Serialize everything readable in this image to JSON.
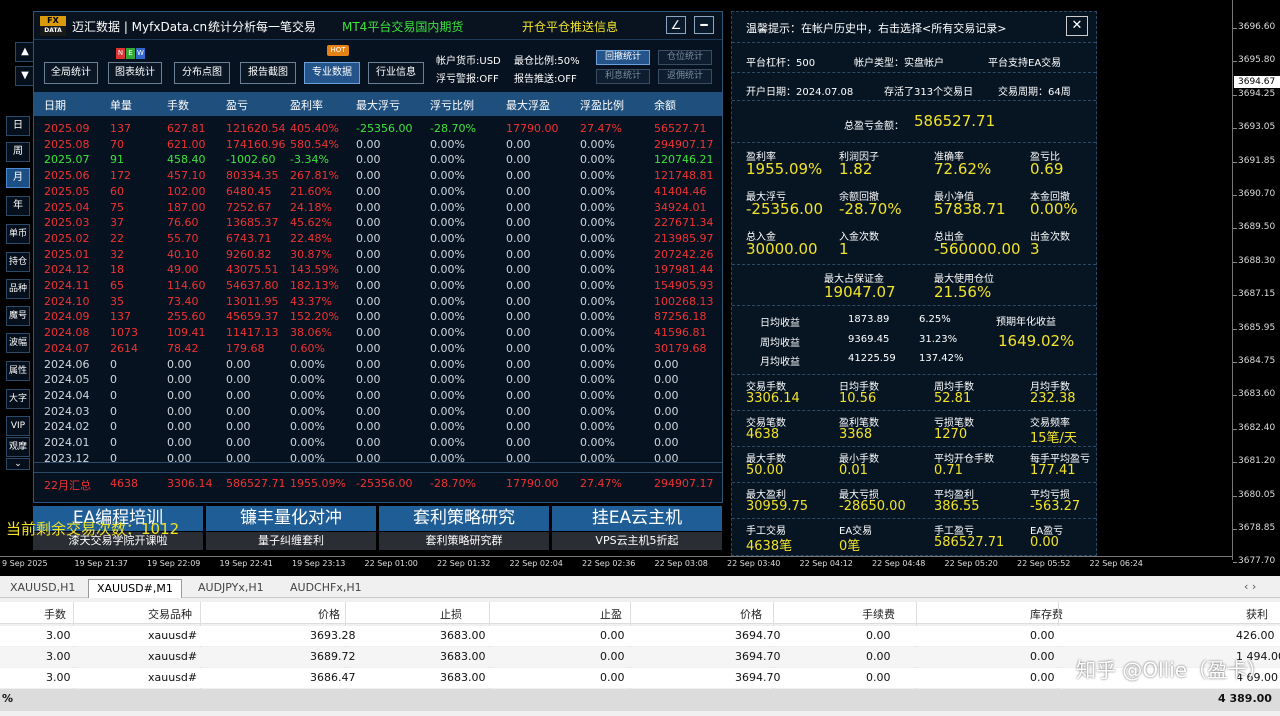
{
  "chart": {
    "price_ticks": [
      "3696.60",
      "3695.80",
      "3694.25",
      "3693.05",
      "3691.85",
      "3690.70",
      "3689.50",
      "3688.30",
      "3687.15",
      "3685.95",
      "3684.75",
      "3683.60",
      "3682.40",
      "3681.20",
      "3680.05",
      "3678.85",
      "3677.70"
    ],
    "current_price": "3694.67",
    "time_ticks": [
      "9 Sep 2025",
      "19 Sep 21:37",
      "19 Sep 22:09",
      "19 Sep 22:41",
      "19 Sep 23:13",
      "22 Sep 01:00",
      "22 Sep 01:32",
      "22 Sep 02:04",
      "22 Sep 02:36",
      "22 Sep 03:08",
      "22 Sep 03:40",
      "22 Sep 04:12",
      "22 Sep 04:48",
      "22 Sep 05:20",
      "22 Sep 05:52",
      "22 Sep 06:24"
    ],
    "up_arrow": "▲",
    "down_arrow": "▼"
  },
  "leftnav": {
    "items": [
      "日",
      "周",
      "月",
      "年",
      "单币",
      "持仓",
      "品种",
      "魔号",
      "波幅",
      "属性",
      "大字",
      "VIP",
      "观摩"
    ],
    "more": "⌄"
  },
  "main": {
    "logo_top": "FX",
    "logo_bottom": "DATA",
    "brand": "迈汇数据 | MyfxData.cn",
    "slogan": "统计分析每一笔交易",
    "promo1": "MT4平台交易国内期货",
    "promo2": "开仓平仓推送信息",
    "edit_icon": "∠",
    "min_icon": "━",
    "new_letters": [
      "N",
      "E",
      "W"
    ],
    "hot_label": "HOT",
    "nav": [
      "全局统计",
      "图表统计",
      "分布点图",
      "报告截图",
      "专业数据",
      "行业信息"
    ],
    "info": {
      "currency": "帐户货币:USD",
      "max_pos": "最仓比例:50%",
      "float_alert": "浮亏警报:OFF",
      "push": "报告推送:OFF"
    },
    "smallbtns": [
      "回撤统计",
      "仓位统计",
      "利息统计",
      "返佣统计"
    ],
    "headers": [
      "日期",
      "单量",
      "手数",
      "盈亏",
      "盈利率",
      "最大浮亏",
      "浮亏比例",
      "最大浮盈",
      "浮盈比例",
      "余额"
    ],
    "rows": [
      [
        "2025.09",
        "137",
        "627.81",
        "121620.54",
        "405.40%",
        "-25356.00",
        "-28.70%",
        "17790.00",
        "27.47%",
        "56527.71"
      ],
      [
        "2025.08",
        "70",
        "621.00",
        "174160.96",
        "580.54%",
        "0.00",
        "0.00%",
        "0.00",
        "0.00%",
        "294907.17"
      ],
      [
        "2025.07",
        "91",
        "458.40",
        "-1002.60",
        "-3.34%",
        "0.00",
        "0.00%",
        "0.00",
        "0.00%",
        "120746.21"
      ],
      [
        "2025.06",
        "172",
        "457.10",
        "80334.35",
        "267.81%",
        "0.00",
        "0.00%",
        "0.00",
        "0.00%",
        "121748.81"
      ],
      [
        "2025.05",
        "60",
        "102.00",
        "6480.45",
        "21.60%",
        "0.00",
        "0.00%",
        "0.00",
        "0.00%",
        "41404.46"
      ],
      [
        "2025.04",
        "75",
        "187.00",
        "7252.67",
        "24.18%",
        "0.00",
        "0.00%",
        "0.00",
        "0.00%",
        "34924.01"
      ],
      [
        "2025.03",
        "37",
        "76.60",
        "13685.37",
        "45.62%",
        "0.00",
        "0.00%",
        "0.00",
        "0.00%",
        "227671.34"
      ],
      [
        "2025.02",
        "22",
        "55.70",
        "6743.71",
        "22.48%",
        "0.00",
        "0.00%",
        "0.00",
        "0.00%",
        "213985.97"
      ],
      [
        "2025.01",
        "32",
        "40.10",
        "9260.82",
        "30.87%",
        "0.00",
        "0.00%",
        "0.00",
        "0.00%",
        "207242.26"
      ],
      [
        "2024.12",
        "18",
        "49.00",
        "43075.51",
        "143.59%",
        "0.00",
        "0.00%",
        "0.00",
        "0.00%",
        "197981.44"
      ],
      [
        "2024.11",
        "65",
        "114.60",
        "54637.80",
        "182.13%",
        "0.00",
        "0.00%",
        "0.00",
        "0.00%",
        "154905.93"
      ],
      [
        "2024.10",
        "35",
        "73.40",
        "13011.95",
        "43.37%",
        "0.00",
        "0.00%",
        "0.00",
        "0.00%",
        "100268.13"
      ],
      [
        "2024.09",
        "137",
        "255.60",
        "45659.37",
        "152.20%",
        "0.00",
        "0.00%",
        "0.00",
        "0.00%",
        "87256.18"
      ],
      [
        "2024.08",
        "1073",
        "109.41",
        "11417.13",
        "38.06%",
        "0.00",
        "0.00%",
        "0.00",
        "0.00%",
        "41596.81"
      ],
      [
        "2024.07",
        "2614",
        "78.42",
        "179.68",
        "0.60%",
        "0.00",
        "0.00%",
        "0.00",
        "0.00%",
        "30179.68"
      ],
      [
        "2024.06",
        "0",
        "0.00",
        "0.00",
        "0.00%",
        "0.00",
        "0.00%",
        "0.00",
        "0.00%",
        "0.00"
      ],
      [
        "2024.05",
        "0",
        "0.00",
        "0.00",
        "0.00%",
        "0.00",
        "0.00%",
        "0.00",
        "0.00%",
        "0.00"
      ],
      [
        "2024.04",
        "0",
        "0.00",
        "0.00",
        "0.00%",
        "0.00",
        "0.00%",
        "0.00",
        "0.00%",
        "0.00"
      ],
      [
        "2024.03",
        "0",
        "0.00",
        "0.00",
        "0.00%",
        "0.00",
        "0.00%",
        "0.00",
        "0.00%",
        "0.00"
      ],
      [
        "2024.02",
        "0",
        "0.00",
        "0.00",
        "0.00%",
        "0.00",
        "0.00%",
        "0.00",
        "0.00%",
        "0.00"
      ],
      [
        "2024.01",
        "0",
        "0.00",
        "0.00",
        "0.00%",
        "0.00",
        "0.00%",
        "0.00",
        "0.00%",
        "0.00"
      ],
      [
        "2023.12",
        "0",
        "0.00",
        "0.00",
        "0.00%",
        "0.00",
        "0.00%",
        "0.00",
        "0.00%",
        "0.00"
      ]
    ],
    "row_colors": [
      "red",
      "red",
      "green",
      "red",
      "red",
      "red",
      "red",
      "red",
      "red",
      "red",
      "red",
      "red",
      "red",
      "red",
      "red",
      "gray",
      "gray",
      "gray",
      "gray",
      "gray",
      "gray",
      "gray"
    ],
    "total": [
      "22月汇总",
      "4638",
      "3306.14",
      "586527.71",
      "1955.09%",
      "-25356.00",
      "-28.70%",
      "17790.00",
      "27.47%",
      "294907.17"
    ]
  },
  "banners": [
    {
      "big": "EA编程培训",
      "small": "漆天交易学院开课啦"
    },
    {
      "big": "镰丰量化对冲",
      "small": "量子纠缠套利"
    },
    {
      "big": "套利策略研究",
      "small": "套利策略研究群"
    },
    {
      "big": "挂EA云主机",
      "small": "VPS云主机5折起"
    }
  ],
  "remain_text": "当前剩余交易次数：1012",
  "right": {
    "tip": "温馨提示：在帐户历史中，右击选择<所有交易记录>",
    "close": "✕",
    "leverage": "平台杠杆：500",
    "acct_type": "帐户类型：实盘帐户",
    "ea_support": "平台支持EA交易",
    "open_date": "开户日期：2024.07.08",
    "alive": "存活了313个交易日",
    "period": "交易周期：64周",
    "total_profit_label": "总盈亏金额：",
    "total_profit": "586527.71",
    "grid1": [
      {
        "l": "盈利率",
        "v": "1955.09%"
      },
      {
        "l": "利润因子",
        "v": "1.82"
      },
      {
        "l": "准确率",
        "v": "72.62%"
      },
      {
        "l": "盈亏比",
        "v": "0.69"
      },
      {
        "l": "最大浮亏",
        "v": "-25356.00"
      },
      {
        "l": "余额回撤",
        "v": "-28.70%"
      },
      {
        "l": "最小净值",
        "v": "57838.71"
      },
      {
        "l": "本金回撤",
        "v": "0.00%"
      },
      {
        "l": "总入金",
        "v": "30000.00"
      },
      {
        "l": "入金次数",
        "v": "1"
      },
      {
        "l": "总出金",
        "v": "-560000.00"
      },
      {
        "l": "出金次数",
        "v": "3"
      }
    ],
    "margin": [
      {
        "l": "最大占保证金",
        "v": "19047.07"
      },
      {
        "l": "最大使用仓位",
        "v": "21.56%"
      }
    ],
    "earn": [
      {
        "l": "日均收益",
        "a": "1873.89",
        "p": "6.25%"
      },
      {
        "l": "周均收益",
        "a": "9369.45",
        "p": "31.23%"
      },
      {
        "l": "月均收益",
        "a": "41225.59",
        "p": "137.42%"
      }
    ],
    "annual_label": "预期年化收益",
    "annual": "1649.02%",
    "grid2": [
      {
        "l": "交易手数",
        "v": "3306.14"
      },
      {
        "l": "日均手数",
        "v": "10.56"
      },
      {
        "l": "周均手数",
        "v": "52.81"
      },
      {
        "l": "月均手数",
        "v": "232.38"
      },
      {
        "l": "交易笔数",
        "v": "4638"
      },
      {
        "l": "盈利笔数",
        "v": "3368"
      },
      {
        "l": "亏损笔数",
        "v": "1270"
      },
      {
        "l": "交易频率",
        "v": "15笔/天"
      },
      {
        "l": "最大手数",
        "v": "50.00"
      },
      {
        "l": "最小手数",
        "v": "0.01"
      },
      {
        "l": "平均开仓手数",
        "v": "0.71"
      },
      {
        "l": "每手平均盈亏",
        "v": "177.41"
      },
      {
        "l": "最大盈利",
        "v": "30959.75"
      },
      {
        "l": "最大亏损",
        "v": "-28650.00"
      },
      {
        "l": "平均盈利",
        "v": "386.55"
      },
      {
        "l": "平均亏损",
        "v": "-563.27"
      },
      {
        "l": "手工交易",
        "v": "4638笔"
      },
      {
        "l": "EA交易",
        "v": "0笔"
      },
      {
        "l": "手工盈亏",
        "v": "586527.71"
      },
      {
        "l": "EA盈亏",
        "v": "0.00"
      }
    ]
  },
  "bottom": {
    "tabs": [
      "XAUUSD,H1",
      "XAUUSD#,M1",
      "AUDJPYx,H1",
      "AUDCHFx,H1"
    ],
    "scroll_icons": "‹ ›",
    "headers": [
      "手数",
      "交易品种",
      "价格",
      "止损",
      "止盈",
      "价格",
      "手续费",
      "库存费",
      "获利"
    ],
    "rows": [
      [
        "3.00",
        "xauusd#",
        "3693.28",
        "3683.00",
        "0.00",
        "3694.70",
        "0.00",
        "0.00",
        "426.00"
      ],
      [
        "3.00",
        "xauusd#",
        "3689.72",
        "3683.00",
        "0.00",
        "3694.70",
        "0.00",
        "0.00",
        "1 494.00"
      ],
      [
        "3.00",
        "xauusd#",
        "3686.47",
        "3683.00",
        "0.00",
        "3694.70",
        "0.00",
        "0.00",
        "4 69.00"
      ]
    ],
    "total_left": "%",
    "total_right": "4 389.00"
  },
  "watermark": "知乎 @Ollie（盈卡）"
}
